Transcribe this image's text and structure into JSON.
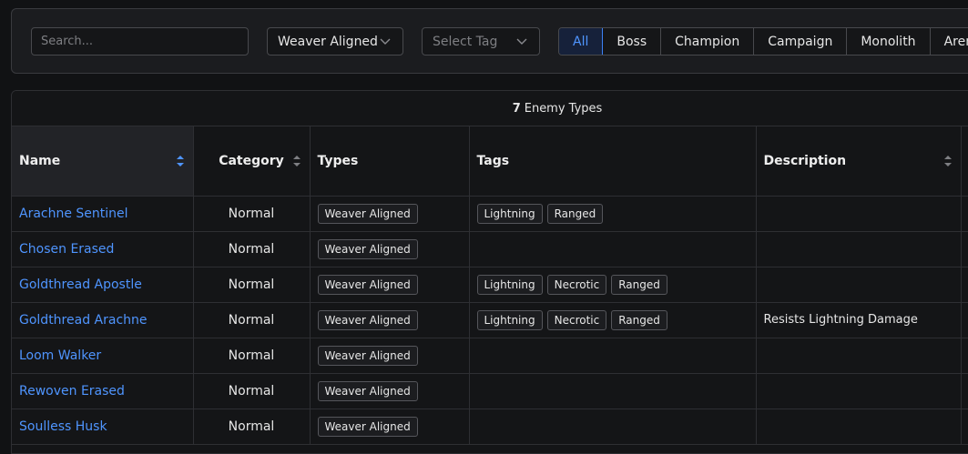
{
  "filters": {
    "search_placeholder": "Search...",
    "type_select": "Weaver Aligned",
    "tag_select_placeholder": "Select Tag",
    "categories": [
      {
        "label": "All",
        "active": true
      },
      {
        "label": "Boss",
        "active": false
      },
      {
        "label": "Champion",
        "active": false
      },
      {
        "label": "Campaign",
        "active": false
      },
      {
        "label": "Monolith",
        "active": false
      },
      {
        "label": "Arena",
        "active": false
      }
    ]
  },
  "summary": {
    "count": "7",
    "label": "Enemy Types"
  },
  "table": {
    "headers": {
      "name": "Name",
      "category": "Category",
      "types": "Types",
      "tags": "Tags",
      "description": "Description"
    },
    "rows": [
      {
        "name": "Arachne Sentinel",
        "category": "Normal",
        "types": [
          "Weaver Aligned"
        ],
        "tags": [
          "Lightning",
          "Ranged"
        ],
        "description": ""
      },
      {
        "name": "Chosen Erased",
        "category": "Normal",
        "types": [
          "Weaver Aligned"
        ],
        "tags": [],
        "description": ""
      },
      {
        "name": "Goldthread Apostle",
        "category": "Normal",
        "types": [
          "Weaver Aligned"
        ],
        "tags": [
          "Lightning",
          "Necrotic",
          "Ranged"
        ],
        "description": ""
      },
      {
        "name": "Goldthread Arachne",
        "category": "Normal",
        "types": [
          "Weaver Aligned"
        ],
        "tags": [
          "Lightning",
          "Necrotic",
          "Ranged"
        ],
        "description": "Resists Lightning Damage"
      },
      {
        "name": "Loom Walker",
        "category": "Normal",
        "types": [
          "Weaver Aligned"
        ],
        "tags": [],
        "description": ""
      },
      {
        "name": "Rewoven Erased",
        "category": "Normal",
        "types": [
          "Weaver Aligned"
        ],
        "tags": [],
        "description": ""
      },
      {
        "name": "Soulless Husk",
        "category": "Normal",
        "types": [
          "Weaver Aligned"
        ],
        "tags": [],
        "description": ""
      }
    ]
  },
  "colors": {
    "accent": "#4f95ff",
    "background": "#111214",
    "panel": "#1b1c1f",
    "border": "#2e2f33"
  }
}
